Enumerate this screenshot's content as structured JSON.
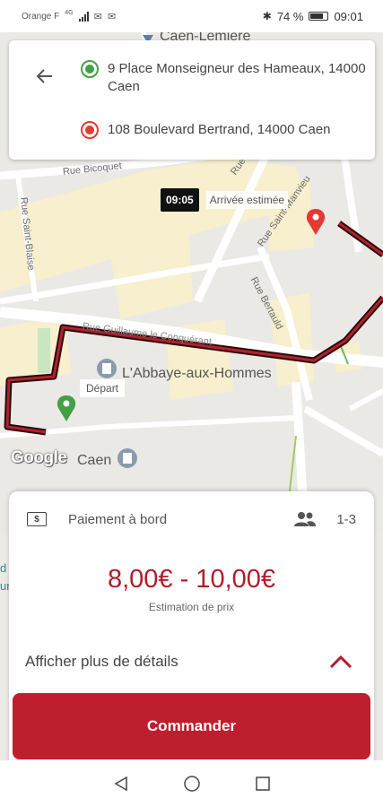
{
  "status_bar": {
    "carrier": "Orange F",
    "network": "4G",
    "battery": "74 %",
    "time": "09:01"
  },
  "map": {
    "labels": {
      "caen_lemiere": "Caen-Lemière",
      "rue_bicoquet": "Rue Bicoquet",
      "rue_saint_blaise": "Rue Saint-Blaise",
      "rue_saint_manvieu": "Rue Saint-Manvieu",
      "rue_saint_manvieu_2": "Rue Saint-",
      "rue_bertauld": "Rue Bertauld",
      "rue_guillaume": "Rue Guillaume le Conquérant",
      "abbaye": "L'Abbaye-aux-Hommes",
      "caen_poi": "Caen"
    },
    "eta_time": "09:05",
    "eta_label": "Arrivée estimée",
    "depart_label": "Départ",
    "google": "Google",
    "route_color": "#7a0f18",
    "origin_pin_color": "#43a047",
    "destination_pin_color": "#e53935"
  },
  "addresses": {
    "origin": "9 Place Monseigneur des Hameaux, 14000 Caen",
    "destination": "108 Boulevard Bertrand, 14000 Caen"
  },
  "sheet": {
    "payment_label": "Paiement à bord",
    "passengers": "1-3",
    "price": "8,00€ - 10,00€",
    "price_sub": "Estimation de prix",
    "details_label": "Afficher plus de détails",
    "order_button": "Commander",
    "peek_d": "d",
    "peek_ur": "ur",
    "accent": "#bf1e2e"
  },
  "icons": {
    "back": "arrow-left-icon",
    "cash": "cash-icon",
    "people": "people-icon",
    "chevron": "chevron-up-icon"
  }
}
